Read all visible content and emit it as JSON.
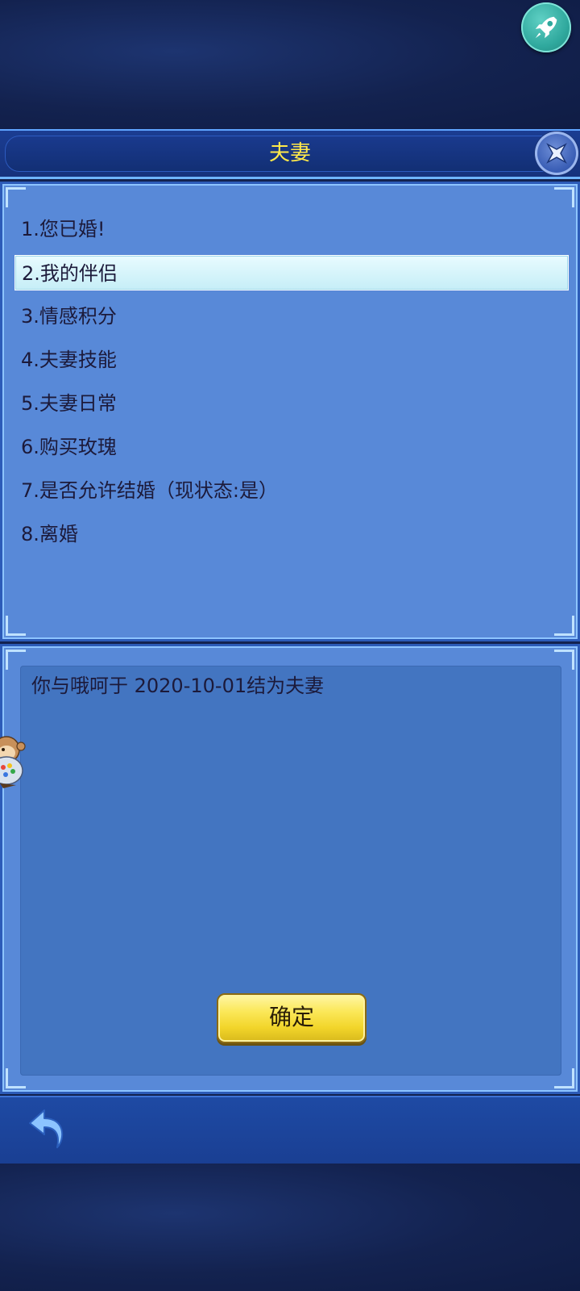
{
  "dialog": {
    "title": "夫妻"
  },
  "menu": {
    "items": [
      {
        "label": "1.您已婚!"
      },
      {
        "label": "2.我的伴侣",
        "selected": true
      },
      {
        "label": "3.情感积分"
      },
      {
        "label": "4.夫妻技能"
      },
      {
        "label": "5.夫妻日常"
      },
      {
        "label": "6.购买玫瑰"
      },
      {
        "label": "7.是否允许结婚（现状态:是）"
      },
      {
        "label": "8.离婚"
      }
    ]
  },
  "message": {
    "text": "你与哦呵于 2020-10-01结为夫妻",
    "confirm_label": "确定"
  },
  "icons": {
    "top_right": "rocket-icon",
    "close": "close-icon",
    "back": "back-arrow-icon",
    "side_float": "monkey-mascot-icon"
  },
  "colors": {
    "title_text": "#ffe94a",
    "panel": "#5889d8",
    "selected_row": "#c6eef7",
    "confirm_button": "#f2d52a"
  }
}
